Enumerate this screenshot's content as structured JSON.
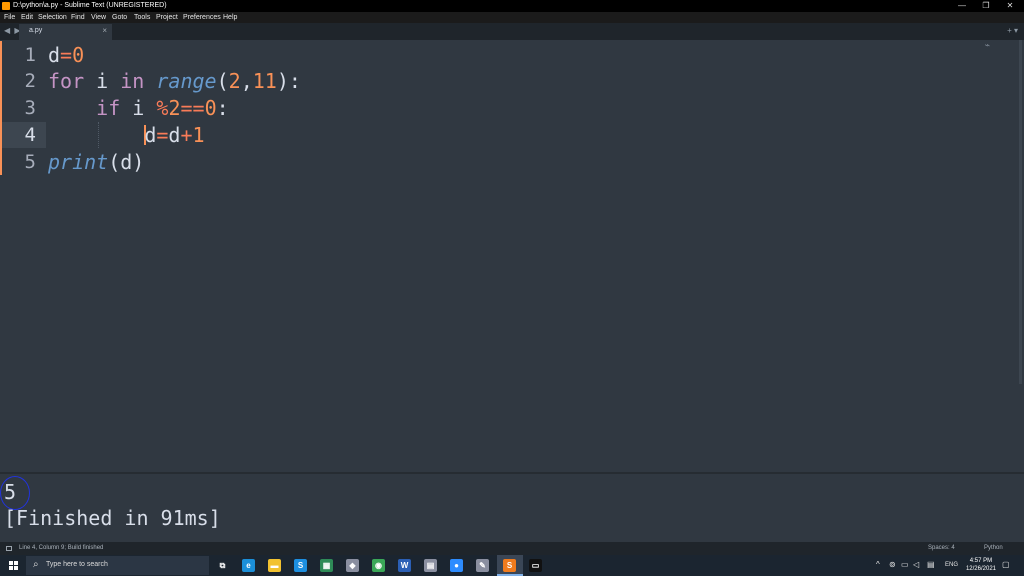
{
  "window": {
    "title": "D:\\python\\a.py - Sublime Text (UNREGISTERED)",
    "minimize": "—",
    "restore": "❐",
    "close": "✕"
  },
  "menu": [
    "File",
    "Edit",
    "Selection",
    "Find",
    "View",
    "Goto",
    "Tools",
    "Project",
    "Preferences",
    "Help"
  ],
  "tabs": {
    "nav": "◀ ▶",
    "active": {
      "label": "a.py",
      "close": "×"
    },
    "right_controls": "+ ▾"
  },
  "editor": {
    "line_numbers": [
      "1",
      "2",
      "3",
      "4",
      "5"
    ],
    "active_line": 4,
    "lines": [
      [
        {
          "t": "d",
          "c": "plain"
        },
        {
          "t": "=",
          "c": "op"
        },
        {
          "t": "0",
          "c": "num"
        }
      ],
      [
        {
          "t": "for",
          "c": "kw"
        },
        {
          "t": " i ",
          "c": "plain"
        },
        {
          "t": "in",
          "c": "kw"
        },
        {
          "t": " ",
          "c": "plain"
        },
        {
          "t": "range",
          "c": "fn"
        },
        {
          "t": "(",
          "c": "plain"
        },
        {
          "t": "2",
          "c": "num"
        },
        {
          "t": ",",
          "c": "plain"
        },
        {
          "t": "11",
          "c": "num"
        },
        {
          "t": "):",
          "c": "plain"
        }
      ],
      [
        {
          "t": "    ",
          "c": "plain"
        },
        {
          "t": "if",
          "c": "kw"
        },
        {
          "t": " i ",
          "c": "plain"
        },
        {
          "t": "%",
          "c": "op"
        },
        {
          "t": "2",
          "c": "num"
        },
        {
          "t": "==",
          "c": "op"
        },
        {
          "t": "0",
          "c": "num"
        },
        {
          "t": ":",
          "c": "plain"
        }
      ],
      [
        {
          "t": "        ",
          "c": "plain"
        },
        {
          "t": "",
          "c": "caret"
        },
        {
          "t": "d",
          "c": "plain"
        },
        {
          "t": "=",
          "c": "op"
        },
        {
          "t": "d",
          "c": "plain"
        },
        {
          "t": "+",
          "c": "op"
        },
        {
          "t": "1",
          "c": "num"
        }
      ],
      [
        {
          "t": "print",
          "c": "fn"
        },
        {
          "t": "(d)",
          "c": "plain"
        }
      ]
    ]
  },
  "output": {
    "result": "5",
    "finished": "[Finished in 91ms]"
  },
  "status": {
    "left": "Line 4, Column 9; Build finished",
    "spaces": "Spaces: 4",
    "syntax": "Python"
  },
  "taskbar": {
    "search_placeholder": "Type here to search",
    "icons": [
      {
        "name": "task-view-icon",
        "glyph": "⧉",
        "color": "#1b2530"
      },
      {
        "name": "edge-icon",
        "glyph": "e",
        "color": "#1b8fd8"
      },
      {
        "name": "file-explorer-icon",
        "glyph": "▬",
        "color": "#f2c230"
      },
      {
        "name": "skype-icon",
        "glyph": "S",
        "color": "#1d8fe0"
      },
      {
        "name": "green-app-icon",
        "glyph": "▦",
        "color": "#2e8b57"
      },
      {
        "name": "app-icon",
        "glyph": "◆",
        "color": "#8a8fa0"
      },
      {
        "name": "chrome-icon",
        "glyph": "◉",
        "color": "#3aa757"
      },
      {
        "name": "word-icon",
        "glyph": "W",
        "color": "#2b5fb5"
      },
      {
        "name": "app2-icon",
        "glyph": "▤",
        "color": "#8a8fa0"
      },
      {
        "name": "zoom-icon",
        "glyph": "●",
        "color": "#2d8cff"
      },
      {
        "name": "notepad-icon",
        "glyph": "✎",
        "color": "#8a8fa0"
      },
      {
        "name": "sublime-icon",
        "glyph": "S",
        "color": "#f07b1d"
      },
      {
        "name": "terminal-icon",
        "glyph": "▭",
        "color": "#111111"
      }
    ],
    "tray": {
      "chevron": "^",
      "lang": "ENG",
      "time": "4:57 PM",
      "date": "12/26/2021"
    }
  }
}
